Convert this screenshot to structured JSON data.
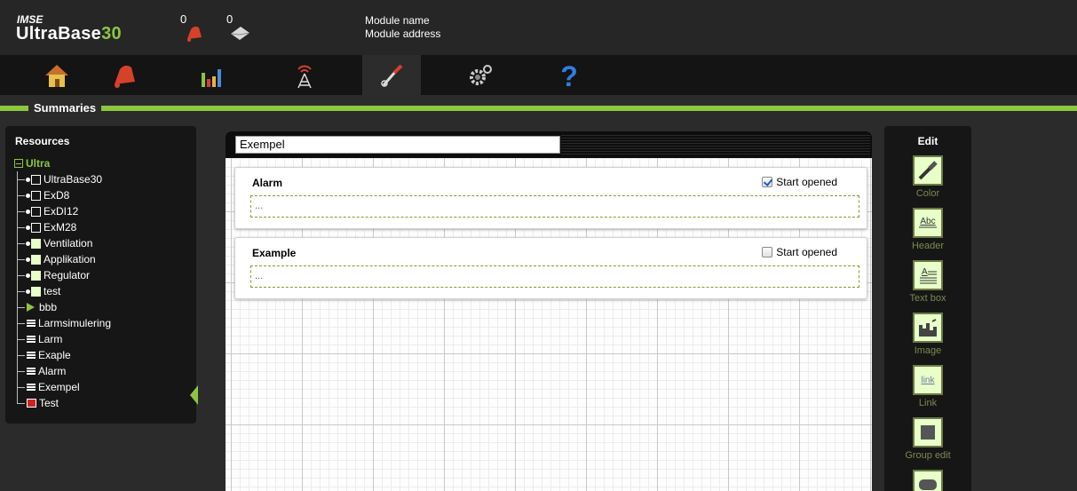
{
  "app": {
    "brand_small": "IMSE",
    "brand_name_prefix": "UltraBase",
    "brand_name_suffix": "30",
    "alarm_count": "0",
    "message_count": "0",
    "module_name": "Module name",
    "module_address": "Module address"
  },
  "nav": [
    {
      "icon": "home-icon"
    },
    {
      "icon": "bell-icon"
    },
    {
      "icon": "bar-chart-icon"
    },
    {
      "icon": "antenna-icon"
    },
    {
      "icon": "tools-icon",
      "active": true
    },
    {
      "icon": "gears-icon"
    },
    {
      "icon": "help-icon"
    }
  ],
  "section": {
    "title": "Summaries"
  },
  "resources": {
    "title": "Resources",
    "root": "Ultra",
    "items": [
      {
        "label": "UltraBase30",
        "kind": "box-empty"
      },
      {
        "label": "ExD8",
        "kind": "box-empty"
      },
      {
        "label": "ExDI12",
        "kind": "box-empty"
      },
      {
        "label": "ExM28",
        "kind": "box-empty"
      },
      {
        "label": "Ventilation",
        "kind": "box-filled"
      },
      {
        "label": "Applikation",
        "kind": "box-filled"
      },
      {
        "label": "Regulator",
        "kind": "box-filled"
      },
      {
        "label": "test",
        "kind": "box-filled"
      },
      {
        "label": "bbb",
        "kind": "play"
      },
      {
        "label": "Larmsimulering",
        "kind": "doc"
      },
      {
        "label": "Larm",
        "kind": "doc"
      },
      {
        "label": "Exaple",
        "kind": "doc"
      },
      {
        "label": "Alarm",
        "kind": "doc"
      },
      {
        "label": "Exempel",
        "kind": "doc"
      },
      {
        "label": "Test",
        "kind": "table"
      }
    ]
  },
  "editor": {
    "summary_title": "Exempel",
    "cards": [
      {
        "title": "Alarm",
        "start_opened_label": "Start opened",
        "start_opened": true,
        "body": "..."
      },
      {
        "title": "Example",
        "start_opened_label": "Start opened",
        "start_opened": false,
        "body": "..."
      }
    ]
  },
  "edit_panel": {
    "title": "Edit",
    "tools": [
      {
        "label": "Color",
        "icon": "brush-icon"
      },
      {
        "label": "Header",
        "icon": "header-icon"
      },
      {
        "label": "Text box",
        "icon": "textbox-icon"
      },
      {
        "label": "Image",
        "icon": "image-icon"
      },
      {
        "label": "Link",
        "icon": "link-icon",
        "glyph": "link"
      },
      {
        "label": "Group edit",
        "icon": "group-edit-icon"
      }
    ]
  },
  "colors": {
    "accent": "#8cc63f",
    "panel": "#161616",
    "background": "#2b2b2b"
  }
}
